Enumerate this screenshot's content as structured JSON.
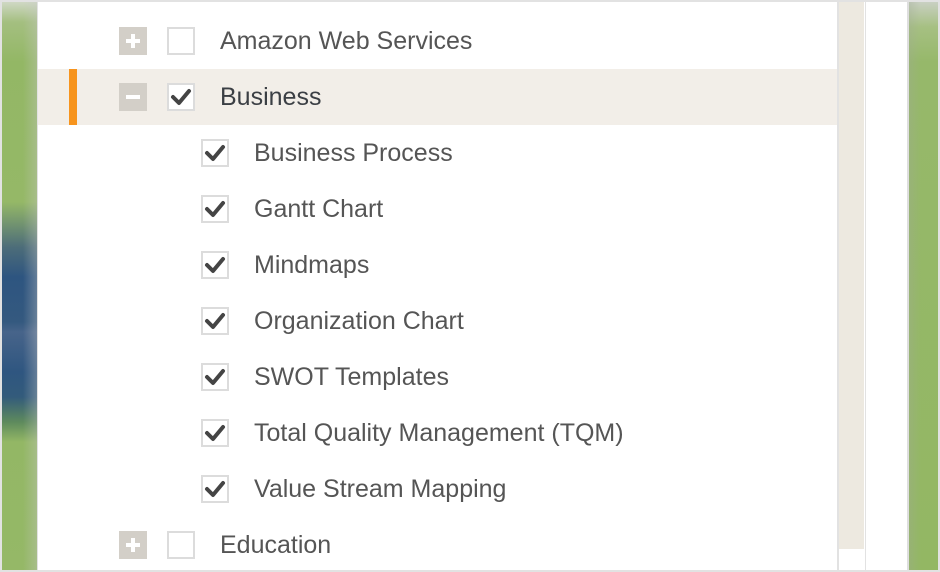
{
  "tree": {
    "items": [
      {
        "label": "Amazon Web Services",
        "level": 0,
        "expander": "plus",
        "checked": false,
        "selected": false
      },
      {
        "label": "Business",
        "level": 0,
        "expander": "minus",
        "checked": true,
        "selected": true
      },
      {
        "label": "Business Process",
        "level": 1,
        "checked": true
      },
      {
        "label": "Gantt Chart",
        "level": 1,
        "checked": true
      },
      {
        "label": "Mindmaps",
        "level": 1,
        "checked": true
      },
      {
        "label": "Organization Chart",
        "level": 1,
        "checked": true
      },
      {
        "label": "SWOT Templates",
        "level": 1,
        "checked": true
      },
      {
        "label": "Total Quality Management (TQM)",
        "level": 1,
        "checked": true
      },
      {
        "label": "Value Stream Mapping",
        "level": 1,
        "checked": true
      },
      {
        "label": "Education",
        "level": 0,
        "expander": "plus",
        "checked": false,
        "selected": false
      }
    ]
  },
  "colors": {
    "accent": "#f7941d",
    "selected_row": "#f2eee8",
    "expander": "#d3cfc8",
    "checkmark": "#444444",
    "scrollbar": "#ede9e0"
  }
}
